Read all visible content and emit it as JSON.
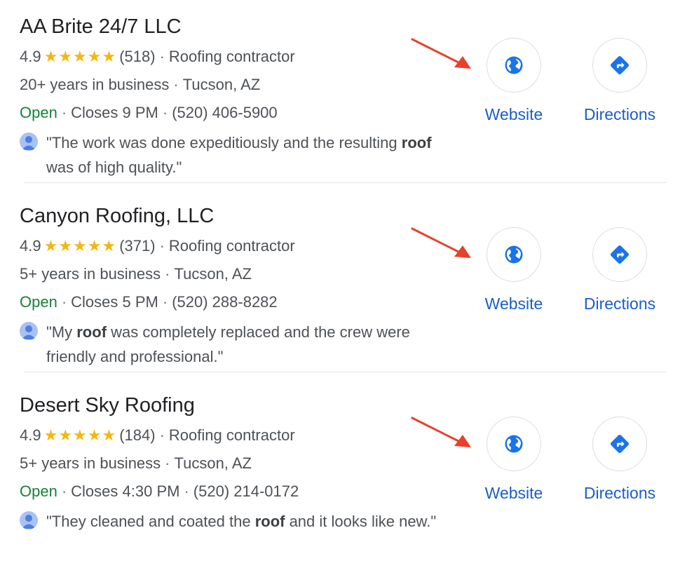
{
  "colors": {
    "star": "#f5b70f",
    "open": "#188038",
    "link": "#1a5ec9",
    "arrow": "#e8402b",
    "icon": "#1a73e8"
  },
  "icons": {
    "website": "globe-icon",
    "directions": "directions-icon",
    "reviewer": "user-avatar-icon"
  },
  "listings": [
    {
      "name": "AA Brite 24/7 LLC",
      "rating": "4.9",
      "stars": "★★★★★",
      "reviews": "(518)",
      "category": "Roofing contractor",
      "years": "20+ years in business",
      "location": "Tucson, AZ",
      "status": "Open",
      "closes": "Closes 9 PM",
      "phone": "(520) 406-5900",
      "quote_before": "\"The work was done expeditiously and the resulting ",
      "quote_bold": "roof",
      "quote_after": " was of high quality.\"",
      "website_label": "Website",
      "directions_label": "Directions"
    },
    {
      "name": "Canyon Roofing, LLC",
      "rating": "4.9",
      "stars": "★★★★★",
      "reviews": "(371)",
      "category": "Roofing contractor",
      "years": "5+ years in business",
      "location": "Tucson, AZ",
      "status": "Open",
      "closes": "Closes 5 PM",
      "phone": "(520) 288-8282",
      "quote_before": "\"My ",
      "quote_bold": "roof",
      "quote_after": " was completely replaced and the crew were friendly and professional.\"",
      "website_label": "Website",
      "directions_label": "Directions"
    },
    {
      "name": "Desert Sky Roofing",
      "rating": "4.9",
      "stars": "★★★★★",
      "reviews": "(184)",
      "category": "Roofing contractor",
      "years": "5+ years in business",
      "location": "Tucson, AZ",
      "status": "Open",
      "closes": "Closes 4:30 PM",
      "phone": "(520) 214-0172",
      "quote_before": "\"They cleaned and coated the ",
      "quote_bold": "roof",
      "quote_after": " and it looks like new.\"",
      "website_label": "Website",
      "directions_label": "Directions"
    }
  ]
}
